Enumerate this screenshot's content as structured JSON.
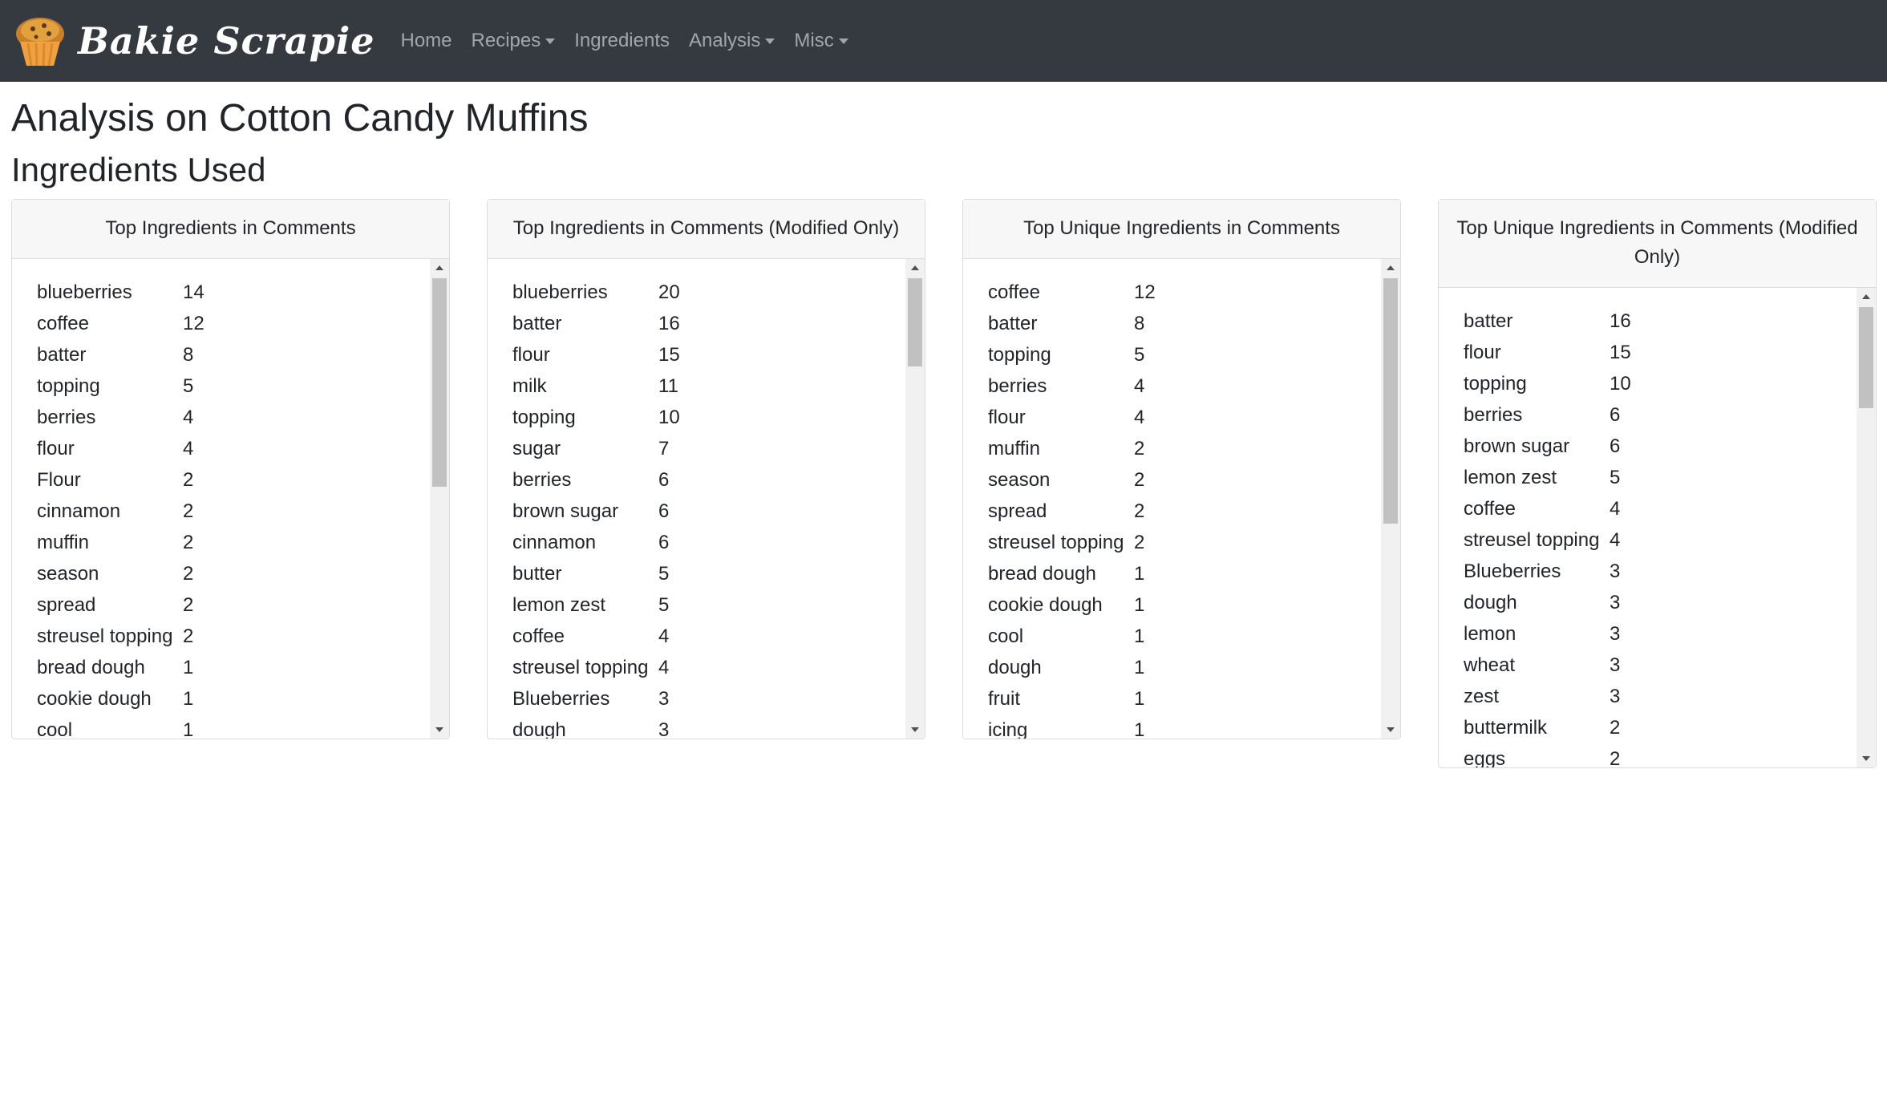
{
  "brand": {
    "name": "Bakie Scrapie",
    "logo_icon": "muffin-icon"
  },
  "nav": {
    "items": [
      {
        "label": "Home",
        "dropdown": false
      },
      {
        "label": "Recipes",
        "dropdown": true
      },
      {
        "label": "Ingredients",
        "dropdown": false
      },
      {
        "label": "Analysis",
        "dropdown": true
      },
      {
        "label": "Misc",
        "dropdown": true
      }
    ]
  },
  "page": {
    "title": "Analysis on Cotton Candy Muffins",
    "section_title": "Ingredients Used"
  },
  "cards": [
    {
      "title": "Top Ingredients in Comments",
      "scroll_fraction": 0.0,
      "rows": [
        {
          "name": "blueberries",
          "count": "14"
        },
        {
          "name": "coffee",
          "count": "12"
        },
        {
          "name": "batter",
          "count": "8"
        },
        {
          "name": "topping",
          "count": "5"
        },
        {
          "name": "berries",
          "count": "4"
        },
        {
          "name": "flour",
          "count": "4"
        },
        {
          "name": "Flour",
          "count": "2"
        },
        {
          "name": "cinnamon",
          "count": "2"
        },
        {
          "name": "muffin",
          "count": "2"
        },
        {
          "name": "season",
          "count": "2"
        },
        {
          "name": "spread",
          "count": "2"
        },
        {
          "name": "streusel topping",
          "count": "2"
        },
        {
          "name": "bread dough",
          "count": "1"
        },
        {
          "name": "cookie dough",
          "count": "1"
        },
        {
          "name": "cool",
          "count": "1"
        }
      ]
    },
    {
      "title": "Top Ingredients in Comments (Modified Only)",
      "scroll_fraction": 0.0,
      "rows": [
        {
          "name": "blueberries",
          "count": "20"
        },
        {
          "name": "batter",
          "count": "16"
        },
        {
          "name": "flour",
          "count": "15"
        },
        {
          "name": "milk",
          "count": "11"
        },
        {
          "name": "topping",
          "count": "10"
        },
        {
          "name": "sugar",
          "count": "7"
        },
        {
          "name": "berries",
          "count": "6"
        },
        {
          "name": "brown sugar",
          "count": "6"
        },
        {
          "name": "cinnamon",
          "count": "6"
        },
        {
          "name": "butter",
          "count": "5"
        },
        {
          "name": "lemon zest",
          "count": "5"
        },
        {
          "name": "coffee",
          "count": "4"
        },
        {
          "name": "streusel topping",
          "count": "4"
        },
        {
          "name": "Blueberries",
          "count": "3"
        },
        {
          "name": "dough",
          "count": "3"
        }
      ]
    },
    {
      "title": "Top Unique Ingredients in Comments",
      "scroll_fraction": 0.0,
      "rows": [
        {
          "name": "coffee",
          "count": "12"
        },
        {
          "name": "batter",
          "count": "8"
        },
        {
          "name": "topping",
          "count": "5"
        },
        {
          "name": "berries",
          "count": "4"
        },
        {
          "name": "flour",
          "count": "4"
        },
        {
          "name": "muffin",
          "count": "2"
        },
        {
          "name": "season",
          "count": "2"
        },
        {
          "name": "spread",
          "count": "2"
        },
        {
          "name": "streusel topping",
          "count": "2"
        },
        {
          "name": "bread dough",
          "count": "1"
        },
        {
          "name": "cookie dough",
          "count": "1"
        },
        {
          "name": "cool",
          "count": "1"
        },
        {
          "name": "dough",
          "count": "1"
        },
        {
          "name": "fruit",
          "count": "1"
        },
        {
          "name": "icing",
          "count": "1"
        }
      ]
    },
    {
      "title": "Top Unique Ingredients in Comments (Modified Only)",
      "scroll_fraction": 0.0,
      "rows": [
        {
          "name": "batter",
          "count": "16"
        },
        {
          "name": "flour",
          "count": "15"
        },
        {
          "name": "topping",
          "count": "10"
        },
        {
          "name": "berries",
          "count": "6"
        },
        {
          "name": "brown sugar",
          "count": "6"
        },
        {
          "name": "lemon zest",
          "count": "5"
        },
        {
          "name": "coffee",
          "count": "4"
        },
        {
          "name": "streusel topping",
          "count": "4"
        },
        {
          "name": "Blueberries",
          "count": "3"
        },
        {
          "name": "dough",
          "count": "3"
        },
        {
          "name": "lemon",
          "count": "3"
        },
        {
          "name": "wheat",
          "count": "3"
        },
        {
          "name": "zest",
          "count": "3"
        },
        {
          "name": "buttermilk",
          "count": "2"
        },
        {
          "name": "eggs",
          "count": "2"
        }
      ]
    }
  ]
}
